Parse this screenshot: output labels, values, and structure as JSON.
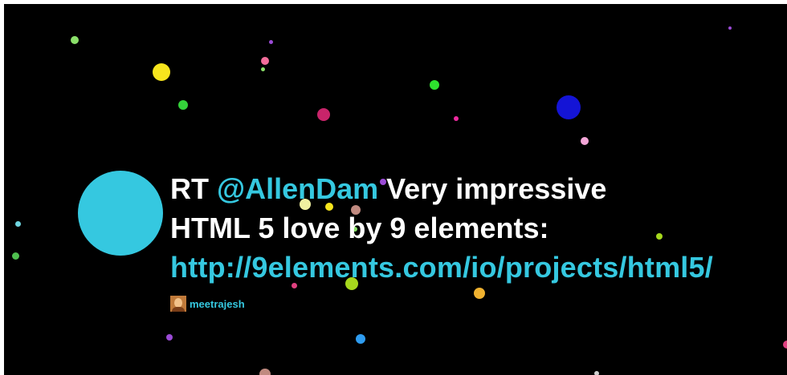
{
  "tweet": {
    "prefix": "RT ",
    "mention": "@AllenDam",
    "line1_rest": " Very impressive",
    "line2": "HTML 5 love by 9 elements:",
    "link": "http://9elements.com/io/projects/html5/"
  },
  "author": {
    "username": "meetrajesh"
  },
  "colors": {
    "background": "#000000",
    "text": "#ffffff",
    "accent": "#35c8e0",
    "avatar_circle": "#35c8e0"
  },
  "particles": [
    {
      "color": "#f7e51d"
    },
    {
      "color": "#8be06a"
    },
    {
      "color": "#34d23a"
    },
    {
      "color": "#f26d9a"
    },
    {
      "color": "#8be06a"
    },
    {
      "color": "#9b4bd6"
    },
    {
      "color": "#2ee02e"
    },
    {
      "color": "#c8246a"
    },
    {
      "color": "#1414d6"
    },
    {
      "color": "#ee2aa0"
    },
    {
      "color": "#f3a6d8"
    },
    {
      "color": "#9b4bd6"
    },
    {
      "color": "#f7e51d"
    },
    {
      "color": "#f0f0a0"
    },
    {
      "color": "#c08a80"
    },
    {
      "color": "#8be06a"
    },
    {
      "color": "#a6d81d"
    },
    {
      "color": "#f0b230"
    },
    {
      "color": "#e04080"
    },
    {
      "color": "#2e9cf0"
    },
    {
      "color": "#9b4bd6"
    },
    {
      "color": "#c08a80"
    },
    {
      "color": "#6fd5e0"
    },
    {
      "color": "#4fbf4f"
    },
    {
      "color": "#9b4bd6"
    },
    {
      "color": "#e04080"
    },
    {
      "color": "#a6d81d"
    },
    {
      "color": "#d0d0d0"
    }
  ]
}
